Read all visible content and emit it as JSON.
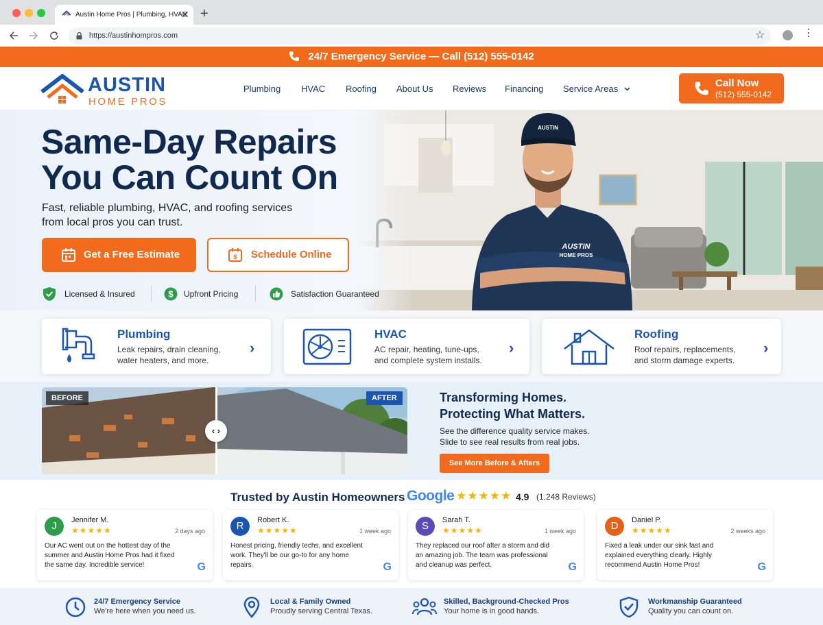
{
  "browser": {
    "tab_title": "Austin Home Pros | Plumbing, HVAC",
    "url": "https://austinhompros.com"
  },
  "topbar": {
    "text": "24/7 Emergency Service — Call (512) 555-0142"
  },
  "logo": {
    "line1": "AUSTIN",
    "line2": "HOME PROS"
  },
  "nav": [
    "Plumbing",
    "HVAC",
    "Roofing",
    "About Us",
    "Reviews",
    "Financing",
    "Service Areas"
  ],
  "call": {
    "label": "Call Now",
    "number": "(512) 555-0142"
  },
  "hero": {
    "title_1": "Same-Day Repairs",
    "title_2": "You Can Count On",
    "subtitle_1": "Fast, reliable plumbing, HVAC, and roofing services",
    "subtitle_2": "from local pros you can trust.",
    "estimate_btn": "Get a Free Estimate",
    "schedule_btn": "Schedule Online",
    "badges": [
      "Licensed & Insured",
      "Upfront Pricing",
      "Satisfaction Guaranteed"
    ],
    "cap_text": "AUSTIN",
    "shirt_1": "AUSTIN",
    "shirt_2": "HOME PROS"
  },
  "services": [
    {
      "title": "Plumbing",
      "desc_1": "Leak repairs, drain cleaning,",
      "desc_2": "water heaters, and more."
    },
    {
      "title": "HVAC",
      "desc_1": "AC repair, heating, tune-ups,",
      "desc_2": "and complete system installs."
    },
    {
      "title": "Roofing",
      "desc_1": "Roof repairs, replacements,",
      "desc_2": "and storm damage experts."
    }
  ],
  "before_after": {
    "before": "BEFORE",
    "after": "AFTER",
    "title_1": "Transforming Homes.",
    "title_2": "Protecting What Matters.",
    "text_1": "See the difference quality service makes.",
    "text_2": "Slide to see real results from real jobs.",
    "button": "See More Before & Afters"
  },
  "reviews_header": {
    "title": "Trusted by Austin Homeowners",
    "google": "Google",
    "stars": "★★★★★",
    "rating": "4.9",
    "count": "(1,248 Reviews)"
  },
  "reviews": [
    {
      "initial": "J",
      "name": "Jennifer M.",
      "date": "2 days ago",
      "stars": "★★★★★",
      "text": "Our AC went out on the hottest day of the summer and Austin Home Pros had it fixed the same day. Incredible service!",
      "color": "#2e9c4a"
    },
    {
      "initial": "R",
      "name": "Robert K.",
      "date": "1 week ago",
      "stars": "★★★★★",
      "text": "Honest pricing, friendly techs, and excellent work. They'll be our go-to for any home repairs.",
      "color": "#1a56b0"
    },
    {
      "initial": "S",
      "name": "Sarah T.",
      "date": "1 week ago",
      "stars": "★★★★★",
      "text": "They replaced our roof after a storm and did an amazing job. The team was professional and cleanup was perfect.",
      "color": "#5b4bb8"
    },
    {
      "initial": "D",
      "name": "Daniel P.",
      "date": "2 weeks ago",
      "stars": "★★★★★",
      "text": "Fixed a leak under our sink fast and explained everything clearly. Highly recommend Austin Home Pros!",
      "color": "#e2621b"
    }
  ],
  "features": [
    {
      "title": "24/7 Emergency Service",
      "text": "We're here when you need us."
    },
    {
      "title": "Local & Family Owned",
      "text": "Proudly serving Central Texas."
    },
    {
      "title": "Skilled, Background-Checked Pros",
      "text": "Your home is in good hands."
    },
    {
      "title": "Workmanship Guaranteed",
      "text": "Quality you can count on."
    }
  ],
  "colors": {
    "brand_orange": "#f26b1d",
    "brand_navy": "#0f2a4e",
    "brand_blue": "#1a56b0"
  }
}
